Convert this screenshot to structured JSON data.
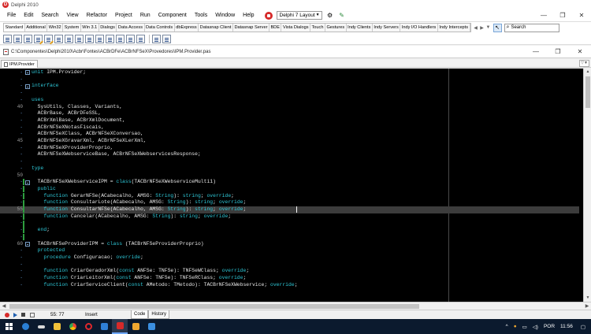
{
  "window": {
    "title": "Delphi 2010",
    "logo_letter": "D"
  },
  "menu": [
    "File",
    "Edit",
    "Search",
    "View",
    "Refactor",
    "Project",
    "Run",
    "Component",
    "Tools",
    "Window",
    "Help"
  ],
  "layout_select": {
    "value": "Delphi 7 Layout"
  },
  "window_controls": {
    "minimize": "—",
    "restore": "❐",
    "close": "✕"
  },
  "palette_tabs": [
    "Standard",
    "Additional",
    "Win32",
    "System",
    "Win 3.1",
    "Dialogs",
    "Data Access",
    "Data Controls",
    "dbExpress",
    "Datasnap Client",
    "Datasnap Server",
    "BDE",
    "Vista Dialogs",
    "Touch",
    "Gestures",
    "Indy Clients",
    "Indy Servers",
    "Indy I/O Handlers",
    "Indy Intercepts"
  ],
  "search": {
    "placeholder": "Search"
  },
  "file_path": "C:\\Componentes\\Delphi2010\\Acbr\\Fontes\\ACBrDFe\\ACBrNFSeX\\Provedores\\IPM.Provider.pas",
  "editor_tab": "IPM.Provider",
  "editor_controls": {
    "minimize": "—",
    "restore": "❐",
    "close": "✕"
  },
  "code_lines": [
    {
      "ln": "-",
      "fold": "open",
      "tokens": [
        [
          "kw",
          "unit "
        ],
        [
          "plain",
          "IPM.Provider;"
        ]
      ]
    },
    {
      "ln": "-",
      "tokens": []
    },
    {
      "ln": "-",
      "fold": "open",
      "tokens": [
        [
          "kw",
          "interface"
        ]
      ]
    },
    {
      "ln": "-",
      "tokens": []
    },
    {
      "ln": "-",
      "tokens": [
        [
          "kw",
          "uses"
        ]
      ]
    },
    {
      "ln": "40",
      "tokens": [
        [
          "plain",
          "  SysUtils, Classes, Variants,"
        ]
      ]
    },
    {
      "ln": "-",
      "tokens": [
        [
          "plain",
          "  ACBrBase, ACBrDFeSSL,"
        ]
      ]
    },
    {
      "ln": "-",
      "tokens": [
        [
          "plain",
          "  ACBrXmlBase, ACBrXmlDocument,"
        ]
      ]
    },
    {
      "ln": "-",
      "tokens": [
        [
          "plain",
          "  ACBrNFSeXNotasFiscais,"
        ]
      ]
    },
    {
      "ln": "-",
      "tokens": [
        [
          "plain",
          "  ACBrNFSeXClass, ACBrNFSeXConversao,"
        ]
      ]
    },
    {
      "ln": "45",
      "tokens": [
        [
          "plain",
          "  ACBrNFSeXGravarXml, ACBrNFSeXLerXml,"
        ]
      ]
    },
    {
      "ln": "-",
      "tokens": [
        [
          "plain",
          "  ACBrNFSeXProviderProprio,"
        ]
      ]
    },
    {
      "ln": "-",
      "tokens": [
        [
          "plain",
          "  ACBrNFSeXWebserviceBase, ACBrNFSeXWebservicesResponse;"
        ]
      ]
    },
    {
      "ln": "-",
      "tokens": []
    },
    {
      "ln": "-",
      "tokens": [
        [
          "kw",
          "type"
        ]
      ]
    },
    {
      "ln": "50",
      "tokens": []
    },
    {
      "ln": "-",
      "fold": "open",
      "tokens": [
        [
          "plain",
          "  TACBrNFSeXWebserviceIPM = "
        ],
        [
          "kw",
          "class"
        ],
        [
          "plain",
          "(TACBrNFSeXWebserviceMulti1)"
        ]
      ]
    },
    {
      "ln": "-",
      "tokens": [
        [
          "kw",
          "  public"
        ]
      ]
    },
    {
      "ln": "-",
      "tokens": [
        [
          "kw",
          "    function "
        ],
        [
          "plain",
          "GerarNFSe(ACabecalho, AMSG: "
        ],
        [
          "kw",
          "String"
        ],
        [
          "plain",
          "): "
        ],
        [
          "kw",
          "string"
        ],
        [
          "plain",
          "; "
        ],
        [
          "kw",
          "override"
        ],
        [
          "plain",
          ";"
        ]
      ]
    },
    {
      "ln": "-",
      "tokens": [
        [
          "kw",
          "    function "
        ],
        [
          "plain",
          "ConsultarLote(ACabecalho, AMSG: "
        ],
        [
          "kw",
          "String"
        ],
        [
          "plain",
          "): "
        ],
        [
          "kw",
          "string"
        ],
        [
          "plain",
          "; "
        ],
        [
          "kw",
          "override"
        ],
        [
          "plain",
          ";"
        ]
      ]
    },
    {
      "ln": "55",
      "cur": true,
      "tokens": [
        [
          "kw",
          "    function "
        ],
        [
          "plain",
          "ConsultarNFSe(ACabecalho, AMSG: "
        ],
        [
          "kw",
          "String"
        ],
        [
          "plain",
          "): "
        ],
        [
          "kw",
          "string"
        ],
        [
          "plain",
          "; "
        ],
        [
          "kw",
          "override"
        ],
        [
          "plain",
          ";"
        ]
      ]
    },
    {
      "ln": "-",
      "tokens": [
        [
          "kw",
          "    function "
        ],
        [
          "plain",
          "Cancelar(ACabecalho, AMSG: "
        ],
        [
          "kw",
          "String"
        ],
        [
          "plain",
          "): "
        ],
        [
          "kw",
          "string"
        ],
        [
          "plain",
          "; "
        ],
        [
          "kw",
          "override"
        ],
        [
          "plain",
          ";"
        ]
      ]
    },
    {
      "ln": "-",
      "tokens": []
    },
    {
      "ln": "-",
      "tokens": [
        [
          "kw",
          "  end"
        ],
        [
          "plain",
          ";"
        ]
      ]
    },
    {
      "ln": "-",
      "tokens": []
    },
    {
      "ln": "60",
      "fold": "open",
      "tokens": [
        [
          "plain",
          "  TACBrNFSeProviderIPM = "
        ],
        [
          "kw",
          "class "
        ],
        [
          "plain",
          "(TACBrNFSeProviderProprio)"
        ]
      ]
    },
    {
      "ln": "-",
      "tokens": [
        [
          "kw",
          "  protected"
        ]
      ]
    },
    {
      "ln": "-",
      "tokens": [
        [
          "kw",
          "    procedure "
        ],
        [
          "plain",
          "Configuracao; "
        ],
        [
          "kw",
          "override"
        ],
        [
          "plain",
          ";"
        ]
      ]
    },
    {
      "ln": "-",
      "tokens": []
    },
    {
      "ln": "-",
      "tokens": [
        [
          "kw",
          "    function "
        ],
        [
          "plain",
          "CriarGeradorXml("
        ],
        [
          "kw",
          "const "
        ],
        [
          "plain",
          "ANFSe: TNFSe): TNFSeWClass; "
        ],
        [
          "kw",
          "override"
        ],
        [
          "plain",
          ";"
        ]
      ]
    },
    {
      "ln": "-",
      "tokens": [
        [
          "kw",
          "    function "
        ],
        [
          "plain",
          "CriarLeitorXml("
        ],
        [
          "kw",
          "const "
        ],
        [
          "plain",
          "ANFSe: TNFSe): TNFSeRClass; "
        ],
        [
          "kw",
          "override"
        ],
        [
          "plain",
          ";"
        ]
      ]
    },
    {
      "ln": "-",
      "tokens": [
        [
          "kw",
          "    function "
        ],
        [
          "plain",
          "CriarServiceClient("
        ],
        [
          "kw",
          "const "
        ],
        [
          "plain",
          "AMetodo: TMetodo): TACBrNFSeXWebservice; "
        ],
        [
          "kw",
          "override"
        ],
        [
          "plain",
          ";"
        ]
      ]
    }
  ],
  "status": {
    "position": "55: 77",
    "mode": "Insert"
  },
  "view_tabs": [
    "Code",
    "History"
  ],
  "taskbar": {
    "language": "POR",
    "time": "11:56"
  },
  "colors": {
    "keyword": "#2ec8d8",
    "editor_bg": "#000000",
    "taskbar_bg": "#0b1a2e",
    "accent_red": "#d62a2a"
  }
}
